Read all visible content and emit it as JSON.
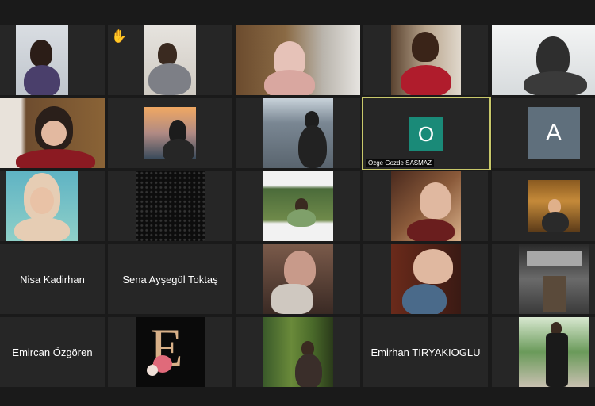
{
  "colors": {
    "background": "#1a1a1a",
    "tile": "#262626",
    "active_border": "#c8c86a",
    "avatar_o": "#1a8a78",
    "avatar_a": "#5f6f7c"
  },
  "participants": {
    "r3c4": {
      "name": "Ozge Gozde SASMAZ",
      "initial": "O"
    },
    "r3c5": {
      "initial": "A"
    },
    "r4c1": {
      "name": "Nisa Kadirhan"
    },
    "r4c2": {
      "name": "Sena Ayşegül Toktaş"
    },
    "r5c1": {
      "name": "Emircan Özgören"
    },
    "r5c2": {
      "letter": "E"
    },
    "r5c4": {
      "name": "Emirhan TIRYAKIOGLU"
    }
  },
  "icons": {
    "raised_hand": "✋"
  }
}
